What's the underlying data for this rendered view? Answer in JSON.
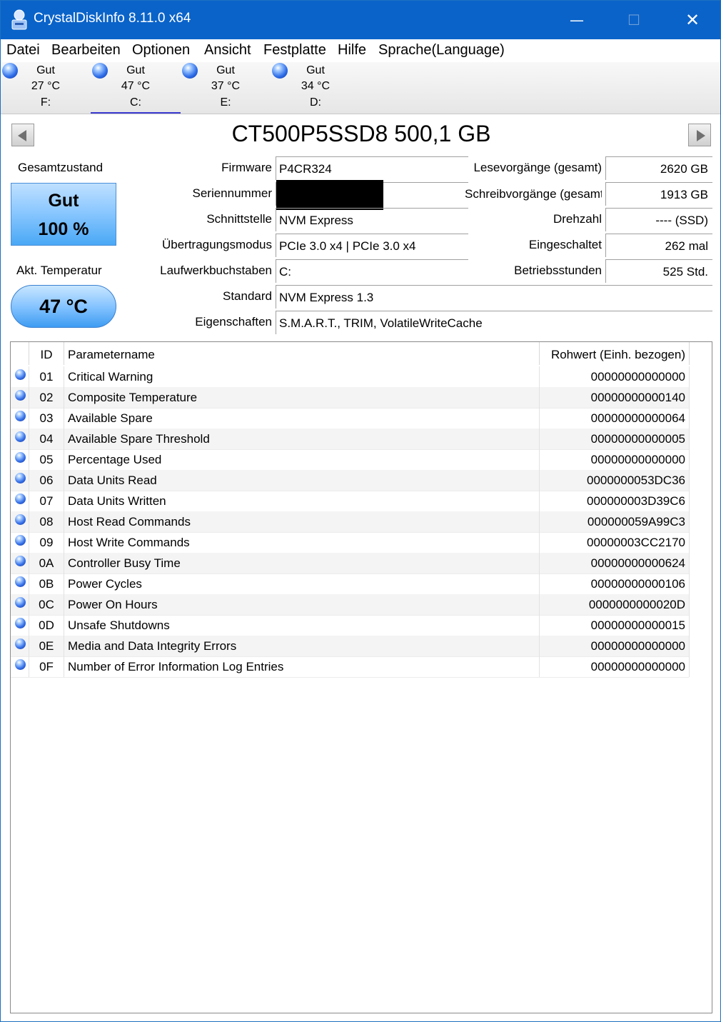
{
  "window": {
    "title": "CrystalDiskInfo 8.11.0 x64"
  },
  "menu": [
    "Datei",
    "Bearbeiten",
    "Optionen",
    "Ansicht",
    "Festplatte",
    "Hilfe",
    "Sprache(Language)"
  ],
  "drives": [
    {
      "status": "Gut",
      "temp": "27 °C",
      "letter": "F:"
    },
    {
      "status": "Gut",
      "temp": "47 °C",
      "letter": "C:"
    },
    {
      "status": "Gut",
      "temp": "37 °C",
      "letter": "E:"
    },
    {
      "status": "Gut",
      "temp": "34 °C",
      "letter": "D:"
    }
  ],
  "model": "CT500P5SSD8 500,1 GB",
  "health": {
    "label": "Gesamtzustand",
    "status": "Gut",
    "percent": "100 %"
  },
  "temperature": {
    "label": "Akt. Temperatur",
    "value": "47 °C"
  },
  "info": {
    "firmware_label": "Firmware",
    "firmware": "P4CR324",
    "serial_label": "Seriennummer",
    "serial": "",
    "interface_label": "Schnittstelle",
    "interface": "NVM Express",
    "transfer_label": "Übertragungsmodus",
    "transfer": "PCIe 3.0 x4 | PCIe 3.0 x4",
    "letters_label": "Laufwerkbuchstaben",
    "letters": "C:",
    "standard_label": "Standard",
    "standard": "NVM Express 1.3",
    "features_label": "Eigenschaften",
    "features": "S.M.A.R.T., TRIM, VolatileWriteCache",
    "reads_label": "Lesevorgänge (gesamt)",
    "reads": "2620 GB",
    "writes_label": "Schreibvorgänge (gesamt)",
    "writes": "1913 GB",
    "rpm_label": "Drehzahl",
    "rpm": "---- (SSD)",
    "power_count_label": "Eingeschaltet",
    "power_count": "262 mal",
    "hours_label": "Betriebsstunden",
    "hours": "525 Std."
  },
  "smart": {
    "headers": {
      "id": "ID",
      "name": "Parametername",
      "raw": "Rohwert (Einh. bezogen)"
    },
    "rows": [
      {
        "id": "01",
        "name": "Critical Warning",
        "raw": "00000000000000"
      },
      {
        "id": "02",
        "name": "Composite Temperature",
        "raw": "00000000000140"
      },
      {
        "id": "03",
        "name": "Available Spare",
        "raw": "00000000000064"
      },
      {
        "id": "04",
        "name": "Available Spare Threshold",
        "raw": "00000000000005"
      },
      {
        "id": "05",
        "name": "Percentage Used",
        "raw": "00000000000000"
      },
      {
        "id": "06",
        "name": "Data Units Read",
        "raw": "0000000053DC36"
      },
      {
        "id": "07",
        "name": "Data Units Written",
        "raw": "000000003D39C6"
      },
      {
        "id": "08",
        "name": "Host Read Commands",
        "raw": "000000059A99C3"
      },
      {
        "id": "09",
        "name": "Host Write Commands",
        "raw": "00000003CC2170"
      },
      {
        "id": "0A",
        "name": "Controller Busy Time",
        "raw": "00000000000624"
      },
      {
        "id": "0B",
        "name": "Power Cycles",
        "raw": "00000000000106"
      },
      {
        "id": "0C",
        "name": "Power On Hours",
        "raw": "0000000000020D"
      },
      {
        "id": "0D",
        "name": "Unsafe Shutdowns",
        "raw": "00000000000015"
      },
      {
        "id": "0E",
        "name": "Media and Data Integrity Errors",
        "raw": "00000000000000"
      },
      {
        "id": "0F",
        "name": "Number of Error Information Log Entries",
        "raw": "00000000000000"
      }
    ]
  },
  "colors": {
    "titlebar": "#0a63c9",
    "status_good": "#2f6ee8",
    "health_box": "#8cc8ff"
  }
}
